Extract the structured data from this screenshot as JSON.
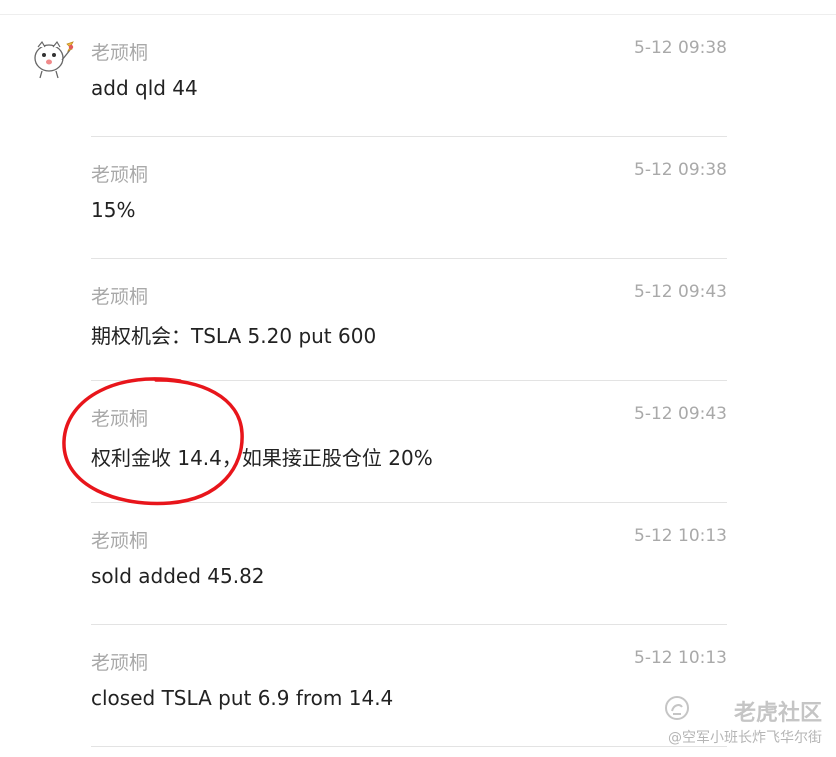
{
  "messages": [
    {
      "sender": "老顽桐",
      "time": "5-12 09:38",
      "text": "add qld 44"
    },
    {
      "sender": "老顽桐",
      "time": "5-12 09:38",
      "text": "15%"
    },
    {
      "sender": "老顽桐",
      "time": "5-12 09:43",
      "text": "期权机会：TSLA 5.20 put 600"
    },
    {
      "sender": "老顽桐",
      "time": "5-12 09:43",
      "text": "权利金收 14.4，如果接正股仓位 20%"
    },
    {
      "sender": "老顽桐",
      "time": "5-12 10:13",
      "text": "sold added 45.82"
    },
    {
      "sender": "老顽桐",
      "time": "5-12 10:13",
      "text": "closed TSLA put 6.9 from 14.4"
    }
  ],
  "watermark": {
    "logo": "老虎社区",
    "user": "@空军小班长炸飞华尔街"
  },
  "colors": {
    "annotation": "#e8151b",
    "meta_text": "#a9a9a9",
    "body_text": "#222222"
  }
}
